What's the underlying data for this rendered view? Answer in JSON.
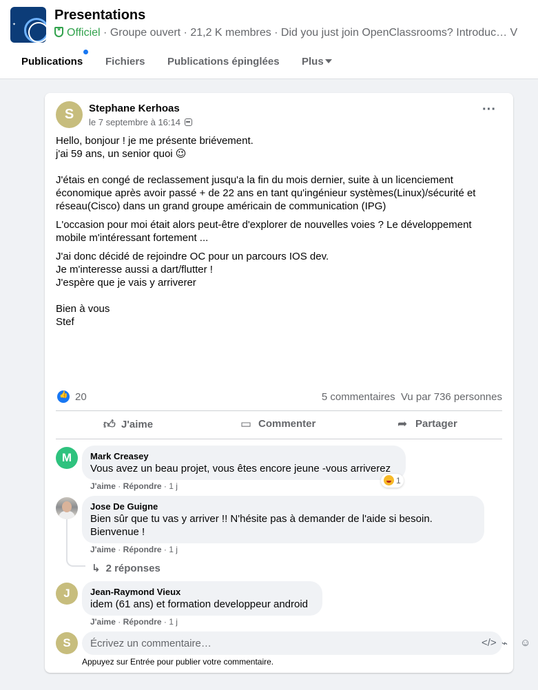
{
  "group": {
    "title": "Presentations",
    "official": "Officiel",
    "meta_rest": " · Groupe ouvert · 21,2 K membres · Did you just join OpenClassrooms? Introduc… V"
  },
  "tabs": [
    {
      "label": "Publications",
      "active": true,
      "has_dot": true
    },
    {
      "label": "Fichiers"
    },
    {
      "label": "Publications épinglées"
    },
    {
      "label": "Plus"
    }
  ],
  "post": {
    "author": "Stephane Kerhoas",
    "author_initial": "S",
    "date": "le 7 septembre à 16:14",
    "lines": [
      "Hello, bonjour ! je me présente briévement.",
      "j'ai 59 ans, un senior quoi 😉",
      "J'étais en congé de reclassement jusqu'a la fin du mois dernier, suite à un licenciement",
      "économique après avoir passé + de 22 ans en tant qu'ingénieur systèmes(Linux)/sécurité et",
      "réseau(Cisco) dans un grand groupe américain de communication (IPG)",
      "L'occasion pour moi était alors peut-être d'explorer de nouvelles voies ? Le développement",
      "mobile m'intéressant fortement ...",
      "J'ai donc décidé de rejoindre OC pour un parcours IOS dev.",
      "Je m'interesse aussi a dart/flutter !",
      "J'espère que je vais y arriverer",
      "Bien à vous",
      "Stef"
    ],
    "like_count": "20",
    "comments_count": "5 commentaires",
    "views": "Vu par 736 personnes"
  },
  "actions": {
    "like": "J'aime",
    "comment": "Commenter",
    "share": "Partager"
  },
  "comments": [
    {
      "initial": "M",
      "name": "Mark Creasey",
      "text": "Vous avez un beau projet, vous êtes encore jeune -vous arriverez",
      "like": "J'aime",
      "reply": "Répondre",
      "time": "1 j",
      "reaction_count": "1"
    },
    {
      "name": "Jose De Guigne",
      "text_lines": [
        "Bien sûr que tu vas y arriver !! N'hésite pas à demander de l'aide si besoin.",
        "Bienvenue !"
      ],
      "like": "J'aime",
      "reply": "Répondre",
      "time": "1 j",
      "replies": "2 réponses"
    },
    {
      "initial": "J",
      "name": "Jean-Raymond Vieux",
      "text": "idem (61 ans) et formation developpeur android",
      "like": "J'aime",
      "reply": "Répondre",
      "time": "1 j"
    }
  ],
  "composer": {
    "initial": "S",
    "placeholder": "Écrivez un commentaire…",
    "hint": "Appuyez sur Entrée pour publier votre commentaire."
  },
  "colors": {
    "accent": "#1877f2",
    "official_green": "#31a24c",
    "avatar_s": "#c7bd7d",
    "avatar_m": "#2ec27e",
    "avatar_j": "#c7bd7d"
  }
}
